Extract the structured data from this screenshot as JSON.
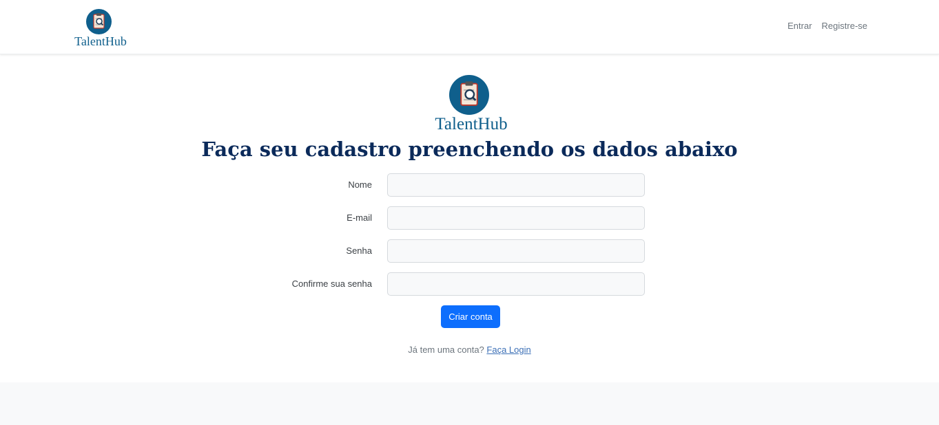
{
  "navbar": {
    "brand_text": "TalentHub",
    "links": [
      "Entrar",
      "Registre-se"
    ]
  },
  "hero": {
    "brand_text": "TalentHub",
    "title": "Faça seu cadastro preenchendo os dados abaixo"
  },
  "form": {
    "fields": [
      {
        "label": "Nome",
        "value": ""
      },
      {
        "label": "E-mail",
        "value": ""
      },
      {
        "label": "Senha",
        "value": ""
      },
      {
        "label": "Confirme sua senha",
        "value": ""
      }
    ],
    "submit_label": "Criar conta",
    "login_prompt": "Já tem uma conta?",
    "login_link": "Faça Login"
  },
  "colors": {
    "brand": "#0f5f8c",
    "title": "#0b2a5a",
    "primary": "#0d6efd"
  },
  "icons": [
    "clipboard-search-logo-icon"
  ]
}
